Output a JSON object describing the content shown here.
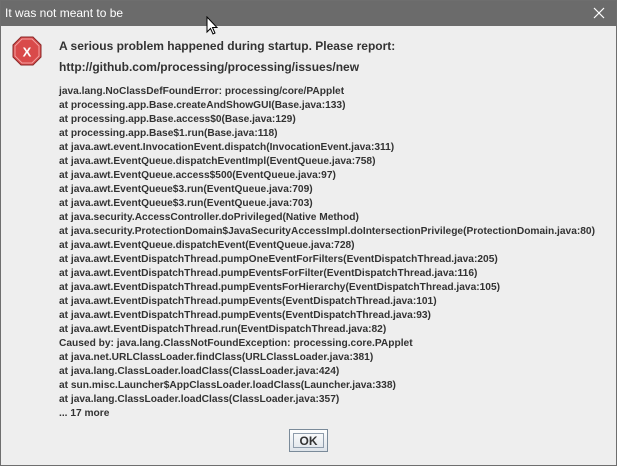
{
  "window": {
    "title": "It was not meant to be"
  },
  "icons": {
    "close": "close-icon",
    "error": "error-icon",
    "cursor": "mouse-pointer-icon"
  },
  "colors": {
    "titlebar": "#6b6b6b",
    "error_icon": "#d94a4a",
    "background": "#eeeeee"
  },
  "dialog": {
    "message_line1": "A serious problem happened during startup. Please report:",
    "message_line2": "http://github.com/processing/processing/issues/new",
    "stack_trace": [
      "java.lang.NoClassDefFoundError: processing/core/PApplet",
      "at processing.app.Base.createAndShowGUI(Base.java:133)",
      "at processing.app.Base.access$0(Base.java:129)",
      "at processing.app.Base$1.run(Base.java:118)",
      "at java.awt.event.InvocationEvent.dispatch(InvocationEvent.java:311)",
      "at java.awt.EventQueue.dispatchEventImpl(EventQueue.java:758)",
      "at java.awt.EventQueue.access$500(EventQueue.java:97)",
      "at java.awt.EventQueue$3.run(EventQueue.java:709)",
      "at java.awt.EventQueue$3.run(EventQueue.java:703)",
      "at java.security.AccessController.doPrivileged(Native Method)",
      "at java.security.ProtectionDomain$JavaSecurityAccessImpl.doIntersectionPrivilege(ProtectionDomain.java:80)",
      "at java.awt.EventQueue.dispatchEvent(EventQueue.java:728)",
      "at java.awt.EventDispatchThread.pumpOneEventForFilters(EventDispatchThread.java:205)",
      "at java.awt.EventDispatchThread.pumpEventsForFilter(EventDispatchThread.java:116)",
      "at java.awt.EventDispatchThread.pumpEventsForHierarchy(EventDispatchThread.java:105)",
      "at java.awt.EventDispatchThread.pumpEvents(EventDispatchThread.java:101)",
      "at java.awt.EventDispatchThread.pumpEvents(EventDispatchThread.java:93)",
      "at java.awt.EventDispatchThread.run(EventDispatchThread.java:82)",
      "Caused by: java.lang.ClassNotFoundException: processing.core.PApplet",
      "at java.net.URLClassLoader.findClass(URLClassLoader.java:381)",
      "at java.lang.ClassLoader.loadClass(ClassLoader.java:424)",
      "at sun.misc.Launcher$AppClassLoader.loadClass(Launcher.java:338)",
      "at java.lang.ClassLoader.loadClass(ClassLoader.java:357)",
      "... 17 more"
    ],
    "ok_label": "OK"
  }
}
